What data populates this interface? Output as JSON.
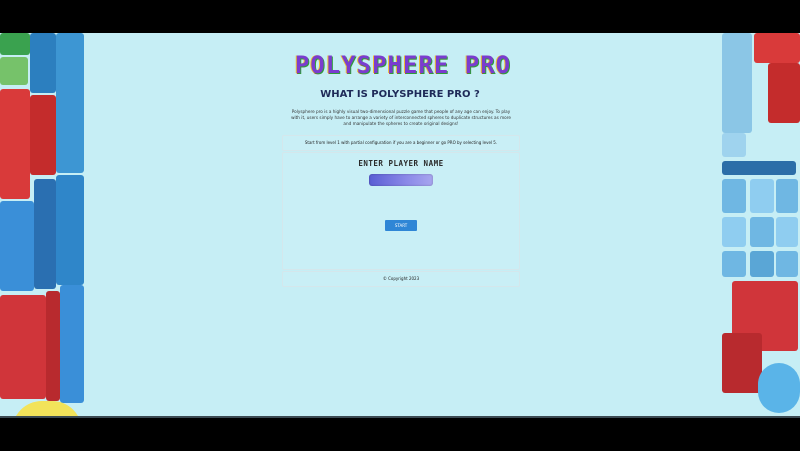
{
  "game": {
    "title": "POLYSPHERE PRO",
    "subtitle": "WHAT IS POLYSPHERE PRO ?",
    "description": "Polysphere pro is a highly visual two-dimensional puzzle game that people of any age can enjoy. To play with it, users simply have to arrange a variety of interconnected spheres to duplicate structures as more and manipulate the spheres to create original designs!",
    "info": "Start from level 1 with partial configuration if you are a beginner or go PRO by selecting level 5.",
    "enter_label": "ENTER PLAYER NAME",
    "name_value": "",
    "start_label": "START",
    "footer": "© Copyright 2023"
  },
  "colors": {
    "background": "#c6eef5",
    "title": "#7a3ccf",
    "subtitle": "#1e2a58",
    "button": "#2f86d6",
    "input_start": "#5a5ed4",
    "input_end": "#a8a6ef"
  }
}
